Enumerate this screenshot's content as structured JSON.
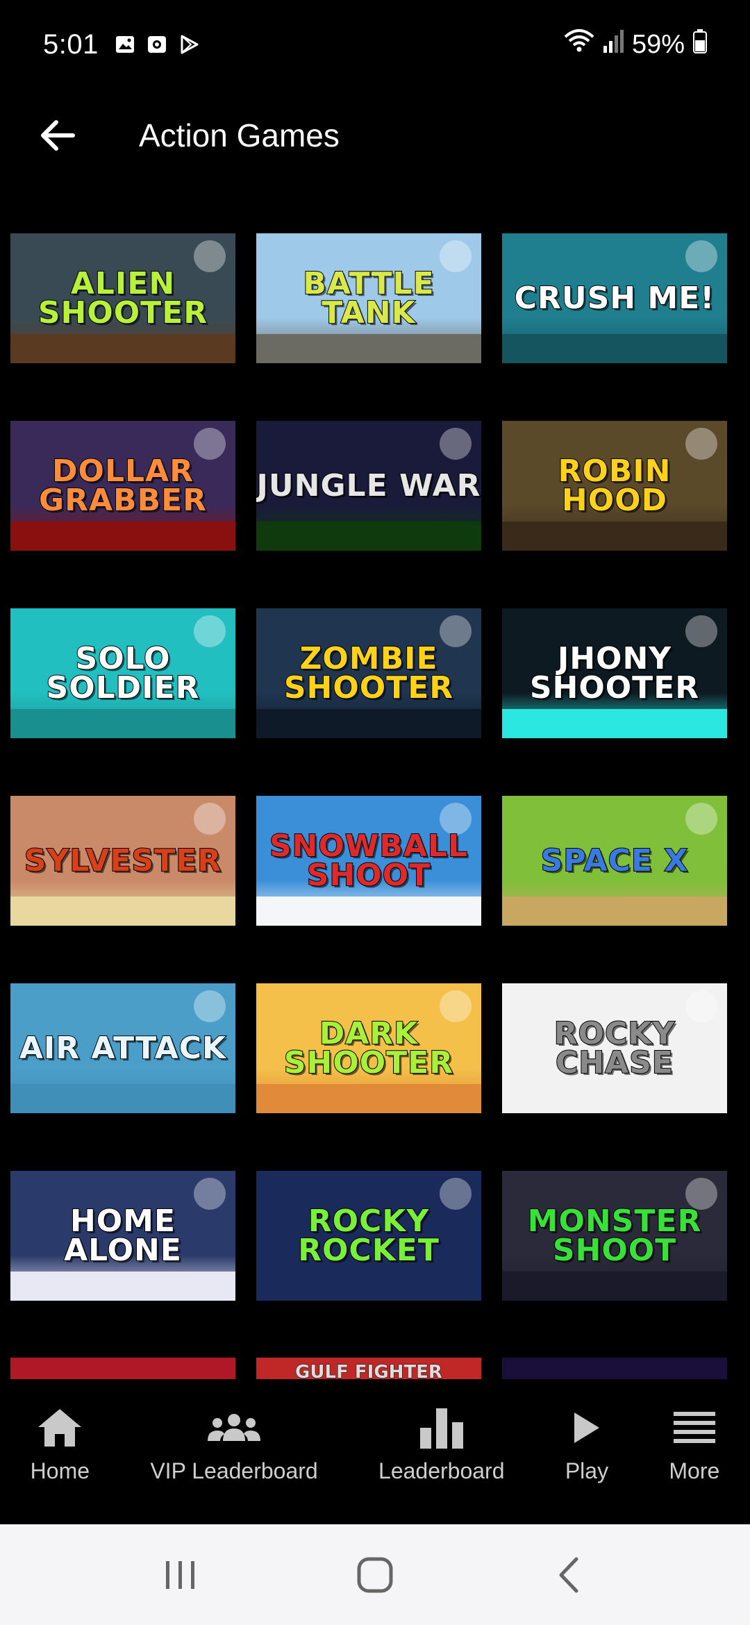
{
  "status_bar": {
    "time": "5:01",
    "battery": "59%"
  },
  "app_bar": {
    "title": "Action Games"
  },
  "games": [
    {
      "title": "ALIEN SHOOTER",
      "bg": "#3a4a55",
      "ground": "#5a3a20",
      "fg": "#b8f03a"
    },
    {
      "title": "BATTLE TANK",
      "bg": "#9ec9e8",
      "ground": "#6b6a63",
      "fg": "#d9e94a"
    },
    {
      "title": "CRUSH ME!",
      "bg": "#1f7f8f",
      "ground": "#14555f",
      "fg": "#ffffff"
    },
    {
      "title": "DOLLAR GRABBER",
      "bg": "#3a2a5a",
      "ground": "#8a1010",
      "fg": "#ff8c3a"
    },
    {
      "title": "JUNGLE WAR",
      "bg": "#1a1a3a",
      "ground": "#0e3a0e",
      "fg": "#e6e6e6"
    },
    {
      "title": "ROBIN HOOD",
      "bg": "#5a4a2a",
      "ground": "#3a2a1a",
      "fg": "#ffd11a"
    },
    {
      "title": "SOLO SOLDIER",
      "bg": "#22bfc0",
      "ground": "#1a8f8f",
      "fg": "#ffffff"
    },
    {
      "title": "ZOMBIE SHOOTER",
      "bg": "#1f3550",
      "ground": "#0e1a28",
      "fg": "#ffd21a"
    },
    {
      "title": "JHONY SHOOTER",
      "bg": "#0d1a22",
      "ground": "#2ae8e0",
      "fg": "#ffffff"
    },
    {
      "title": "SYLVESTER",
      "bg": "#c98a6a",
      "ground": "#e8d8a0",
      "fg": "#d8401a"
    },
    {
      "title": "SNOWBALL SHOOT",
      "bg": "#3a8fd8",
      "ground": "#f4f6fa",
      "fg": "#e02a2a"
    },
    {
      "title": "SPACE X",
      "bg": "#7fbf3a",
      "ground": "#c8a860",
      "fg": "#3a7ae0"
    },
    {
      "title": "AIR ATTACK",
      "bg": "#4a9ec8",
      "ground": "#3f8fb8",
      "fg": "#eaf6ff"
    },
    {
      "title": "DARK SHOOTER",
      "bg": "#f4c04a",
      "ground": "#e08a3a",
      "fg": "#a8f03a"
    },
    {
      "title": "ROCKY CHASE",
      "bg": "#f2f2f2",
      "ground": "#f2f2f2",
      "fg": "#8a8a8a"
    },
    {
      "title": "Home Alone",
      "bg": "#2a3a6a",
      "ground": "#e8e8f4",
      "fg": "#ffffff"
    },
    {
      "title": "ROCKY ROCKET",
      "bg": "#1a2a5a",
      "ground": "#1a2a5a",
      "fg": "#7aef3a"
    },
    {
      "title": "MONSTER SHOOT",
      "bg": "#2a2a3a",
      "ground": "#1a1a2a",
      "fg": "#3ae03a"
    }
  ],
  "partial_row": [
    {
      "title": "",
      "bg": "#b01828"
    },
    {
      "title": "GULF FIGHTER",
      "bg": "#c02828"
    },
    {
      "title": "",
      "bg": "#1a0e3a"
    }
  ],
  "bottom_nav": [
    {
      "label": "Home",
      "icon": "home-icon"
    },
    {
      "label": "VIP Leaderboard",
      "icon": "group-icon"
    },
    {
      "label": "Leaderboard",
      "icon": "bar-chart-icon"
    },
    {
      "label": "Play",
      "icon": "play-icon"
    },
    {
      "label": "More",
      "icon": "menu-icon"
    }
  ],
  "system_nav": [
    "recents-icon",
    "home-circle-icon",
    "back-chevron-icon"
  ]
}
